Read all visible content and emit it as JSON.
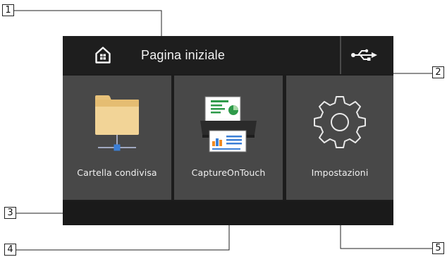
{
  "header": {
    "title": "Pagina iniziale",
    "home_icon": "home-icon",
    "usb_icon": "usb-icon"
  },
  "tiles": [
    {
      "label": "Cartella condivisa",
      "icon": "shared-folder-icon"
    },
    {
      "label": "CaptureOnTouch",
      "icon": "scanner-icon"
    },
    {
      "label": "Impostazioni",
      "icon": "gear-icon"
    }
  ],
  "callouts": [
    "1",
    "2",
    "3",
    "4",
    "5"
  ],
  "colors": {
    "background": "#1c1c1c",
    "tile": "#484848",
    "text": "#f0f0f0",
    "folder": "#f2d497"
  }
}
